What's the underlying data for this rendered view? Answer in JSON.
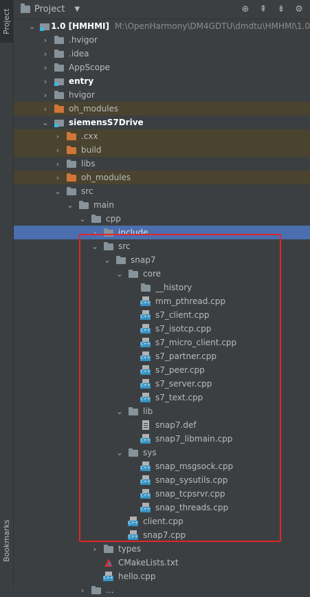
{
  "sidebar": {
    "project_tab": "Project",
    "bookmarks_tab": "Bookmarks"
  },
  "header": {
    "title": "Project",
    "icons": [
      "target-icon",
      "collapse-icon",
      "expand-icon",
      "gear-icon"
    ]
  },
  "tree": [
    {
      "label": "1.0 [HMHMI]",
      "path": "M:\\OpenHarmony\\DM4GDTU\\dmdtu\\HMHMI\\1.0",
      "depth": 0,
      "expanded": true,
      "icon": "module",
      "style": "bold"
    },
    {
      "label": ".hvigor",
      "depth": 1,
      "expanded": false,
      "icon": "folder"
    },
    {
      "label": ".idea",
      "depth": 1,
      "expanded": false,
      "icon": "folder"
    },
    {
      "label": "AppScope",
      "depth": 1,
      "expanded": false,
      "icon": "folder"
    },
    {
      "label": "entry",
      "depth": 1,
      "expanded": false,
      "icon": "module",
      "style": "bold"
    },
    {
      "label": "hvigor",
      "depth": 1,
      "expanded": false,
      "icon": "folder"
    },
    {
      "label": "oh_modules",
      "depth": 1,
      "expanded": false,
      "icon": "folder-orange",
      "excluded": true
    },
    {
      "label": "siemensS7Drive",
      "depth": 1,
      "expanded": true,
      "icon": "module",
      "style": "bold"
    },
    {
      "label": ".cxx",
      "depth": 2,
      "expanded": false,
      "icon": "folder-orange",
      "excluded": true
    },
    {
      "label": "build",
      "depth": 2,
      "expanded": false,
      "icon": "folder-orange",
      "excluded": true
    },
    {
      "label": "libs",
      "depth": 2,
      "expanded": false,
      "icon": "folder"
    },
    {
      "label": "oh_modules",
      "depth": 2,
      "expanded": false,
      "icon": "folder-orange",
      "excluded": true
    },
    {
      "label": "src",
      "depth": 2,
      "expanded": true,
      "icon": "folder"
    },
    {
      "label": "main",
      "depth": 3,
      "expanded": true,
      "icon": "folder"
    },
    {
      "label": "cpp",
      "depth": 4,
      "expanded": true,
      "icon": "folder"
    },
    {
      "label": "include",
      "depth": 5,
      "expanded": false,
      "icon": "folder",
      "selected": true
    },
    {
      "label": "src",
      "depth": 5,
      "expanded": true,
      "icon": "folder"
    },
    {
      "label": "snap7",
      "depth": 6,
      "expanded": true,
      "icon": "folder"
    },
    {
      "label": "core",
      "depth": 7,
      "expanded": true,
      "icon": "folder"
    },
    {
      "label": "__history",
      "depth": 8,
      "icon": "folder"
    },
    {
      "label": "mm_pthread.cpp",
      "depth": 8,
      "icon": "cpp"
    },
    {
      "label": "s7_client.cpp",
      "depth": 8,
      "icon": "cpp"
    },
    {
      "label": "s7_isotcp.cpp",
      "depth": 8,
      "icon": "cpp"
    },
    {
      "label": "s7_micro_client.cpp",
      "depth": 8,
      "icon": "cpp"
    },
    {
      "label": "s7_partner.cpp",
      "depth": 8,
      "icon": "cpp"
    },
    {
      "label": "s7_peer.cpp",
      "depth": 8,
      "icon": "cpp"
    },
    {
      "label": "s7_server.cpp",
      "depth": 8,
      "icon": "cpp"
    },
    {
      "label": "s7_text.cpp",
      "depth": 8,
      "icon": "cpp"
    },
    {
      "label": "lib",
      "depth": 7,
      "expanded": true,
      "icon": "folder"
    },
    {
      "label": "snap7.def",
      "depth": 8,
      "icon": "def"
    },
    {
      "label": "snap7_libmain.cpp",
      "depth": 8,
      "icon": "cpp"
    },
    {
      "label": "sys",
      "depth": 7,
      "expanded": true,
      "icon": "folder"
    },
    {
      "label": "snap_msgsock.cpp",
      "depth": 8,
      "icon": "cpp"
    },
    {
      "label": "snap_sysutils.cpp",
      "depth": 8,
      "icon": "cpp"
    },
    {
      "label": "snap_tcpsrvr.cpp",
      "depth": 8,
      "icon": "cpp"
    },
    {
      "label": "snap_threads.cpp",
      "depth": 8,
      "icon": "cpp"
    },
    {
      "label": "client.cpp",
      "depth": 7,
      "icon": "cpp"
    },
    {
      "label": "snap7.cpp",
      "depth": 7,
      "icon": "cpp"
    },
    {
      "label": "types",
      "depth": 5,
      "expanded": false,
      "icon": "folder"
    },
    {
      "label": "CMakeLists.txt",
      "depth": 5,
      "icon": "cmake"
    },
    {
      "label": "hello.cpp",
      "depth": 5,
      "icon": "cpp"
    },
    {
      "label": "...",
      "depth": 4,
      "expanded": false,
      "icon": "folder"
    }
  ]
}
